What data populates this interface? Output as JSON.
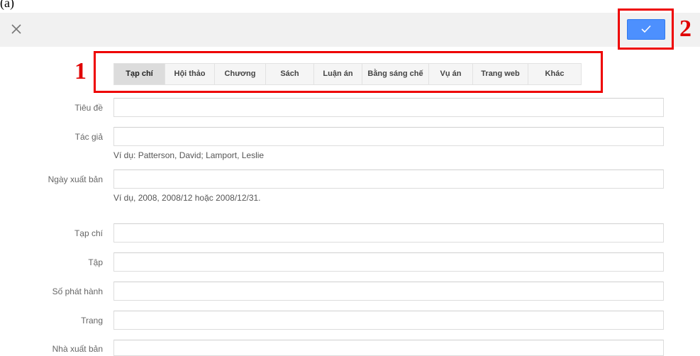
{
  "top_fragment": "(a)",
  "tabs": [
    {
      "label": "Tạp chí",
      "active": true
    },
    {
      "label": "Hội thảo",
      "active": false
    },
    {
      "label": "Chương",
      "active": false
    },
    {
      "label": "Sách",
      "active": false
    },
    {
      "label": "Luận án",
      "active": false
    },
    {
      "label": "Bằng sáng chế",
      "active": false
    },
    {
      "label": "Vụ án",
      "active": false
    },
    {
      "label": "Trang web",
      "active": false
    },
    {
      "label": "Khác",
      "active": false
    }
  ],
  "fields": {
    "title": {
      "label": "Tiêu đề",
      "value": ""
    },
    "authors": {
      "label": "Tác giả",
      "value": "",
      "hint": "Ví dụ: Patterson, David; Lamport, Leslie"
    },
    "publication_date": {
      "label": "Ngày xuất bản",
      "value": "",
      "hint": "Ví dụ, 2008, 2008/12 hoặc 2008/12/31."
    },
    "journal": {
      "label": "Tạp chí",
      "value": ""
    },
    "volume": {
      "label": "Tập",
      "value": ""
    },
    "issue": {
      "label": "Số phát hành",
      "value": ""
    },
    "pages": {
      "label": "Trang",
      "value": ""
    },
    "publisher": {
      "label": "Nhà xuất bản",
      "value": ""
    }
  },
  "annotations": {
    "tabs_marker": "1",
    "save_marker": "2"
  },
  "colors": {
    "accent": "#4d90fe",
    "annotation": "#ee0000",
    "toolbar": "#f1f1f1"
  },
  "icons": {
    "close": "close-icon",
    "save": "check-icon"
  }
}
